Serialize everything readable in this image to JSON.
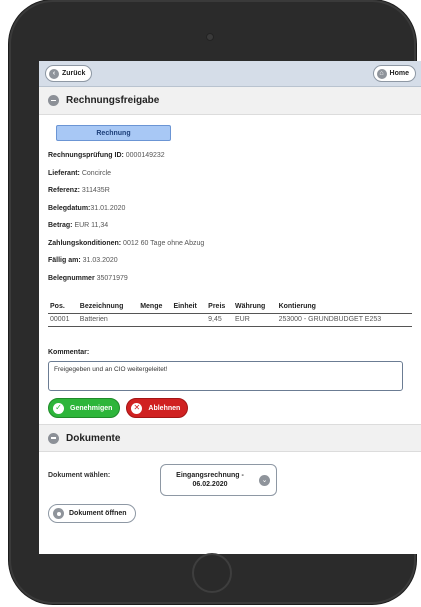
{
  "nav": {
    "back_label": "Zurück",
    "home_label": "Home"
  },
  "invoice_section": {
    "title": "Rechnungsfreigabe",
    "tab_label": "Rechnung",
    "fields": [
      {
        "label": "Rechnungsprüfung ID:",
        "value": " 0000149232"
      },
      {
        "label": "Lieferant:",
        "value": " Concircle"
      },
      {
        "label": "Referenz:",
        "value": " 311435R"
      },
      {
        "label": "Belegdatum:",
        "value": "31.01.2020"
      },
      {
        "label": "Betrag:",
        "value": " EUR 11,34"
      },
      {
        "label": "Zahlungskonditionen:",
        "value": " 0012 60 Tage ohne Abzug"
      },
      {
        "label": "Fällig am:",
        "value": " 31.03.2020"
      },
      {
        "label": "Belegnummer",
        "value": " 35071979"
      }
    ],
    "table": {
      "headers": [
        "Pos.",
        "Bezeichnung",
        "Menge",
        "Einheit",
        "Preis",
        "Währung",
        "Kontierung"
      ],
      "rows": [
        [
          "00001",
          "Batterien",
          "",
          "",
          "9,45",
          "EUR",
          "253000 - GRUNDBUDGET E253"
        ]
      ]
    },
    "comment_label": "Kommentar:",
    "comment_value": "Freigegeben und an CIO weitergeleitet!",
    "approve_label": "Genehmigen",
    "reject_label": "Ablehnen"
  },
  "documents_section": {
    "title": "Dokumente",
    "select_label": "Dokument wählen:",
    "selected_document_line1": "Eingangsrechnung -",
    "selected_document_line2": "06.02.2020",
    "open_label": "Dokument öffnen"
  },
  "icons": {
    "back": "back-arrow-icon",
    "home": "home-icon",
    "collapse": "minus-circle-icon",
    "approve": "check-icon",
    "reject": "x-icon",
    "dropdown": "chevron-down-icon",
    "open": "dot-circle-icon"
  },
  "colors": {
    "approve": "#2db53a",
    "reject": "#d02121",
    "tab": "#a8c8f5",
    "topbar": "#d5dde8",
    "device": "#2b2b2b"
  }
}
